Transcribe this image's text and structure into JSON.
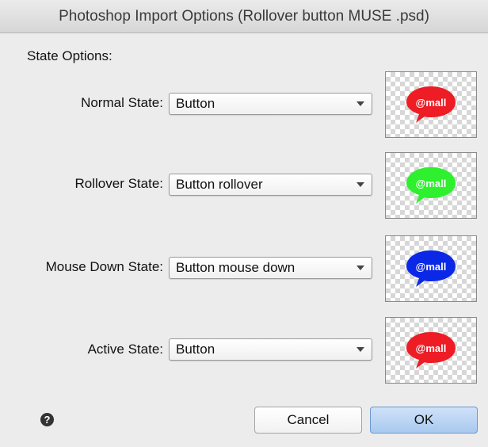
{
  "window": {
    "title": "Photoshop Import Options (Rollover button MUSE .psd)"
  },
  "section": {
    "label": "State Options:"
  },
  "states": [
    {
      "label": "Normal State:",
      "value": "Button",
      "bubble_color": "#ee1c24",
      "bubble_text": "@mall"
    },
    {
      "label": "Rollover State:",
      "value": "Button rollover",
      "bubble_color": "#2ef02e",
      "bubble_text": "@mall"
    },
    {
      "label": "Mouse Down State:",
      "value": "Button mouse down",
      "bubble_color": "#0a28e6",
      "bubble_text": "@mall"
    },
    {
      "label": "Active State:",
      "value": "Button",
      "bubble_color": "#ee1c24",
      "bubble_text": "@mall"
    }
  ],
  "footer": {
    "help_glyph": "?",
    "cancel_label": "Cancel",
    "ok_label": "OK"
  },
  "colors": {
    "ok_button": "#a9c9ef",
    "dialog_bg": "#ececec"
  },
  "icons": {
    "help": "question-circle-icon",
    "dropdown": "chevron-down-icon"
  }
}
